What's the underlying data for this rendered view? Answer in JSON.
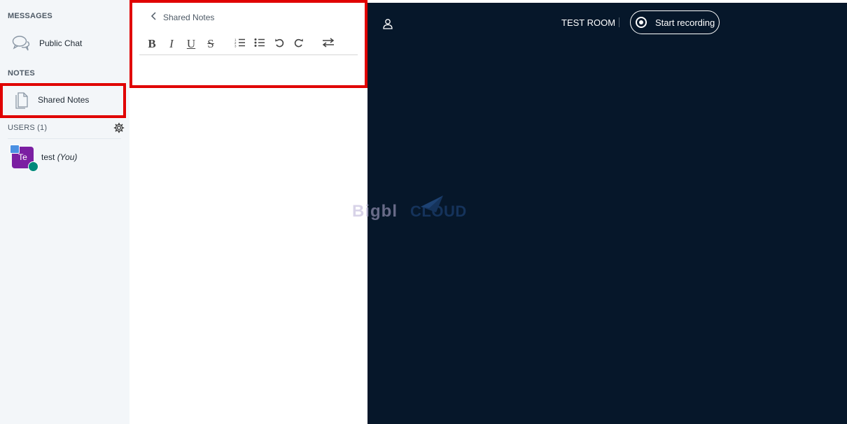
{
  "sidebar": {
    "messages_title": "MESSAGES",
    "public_chat_label": "Public Chat",
    "notes_title": "NOTES",
    "shared_notes_label": "Shared Notes",
    "users_title": "USERS (1)",
    "user": {
      "initials": "Te",
      "name": "test",
      "you_label": "(You)",
      "avatar_color": "#7b1fa2"
    }
  },
  "notes_panel": {
    "title": "Shared Notes",
    "toolbar": {
      "bold": "B",
      "italic": "I",
      "underline": "U",
      "strike": "S"
    }
  },
  "main": {
    "room_name": "TEST ROOM",
    "record_label": "Start recording",
    "background_color": "#06172a"
  },
  "logo": {
    "text_a": "Bigbl",
    "text_b": "CLOUD"
  },
  "colors": {
    "highlight": "#e00000",
    "sidebar_bg": "#f3f6f9"
  }
}
